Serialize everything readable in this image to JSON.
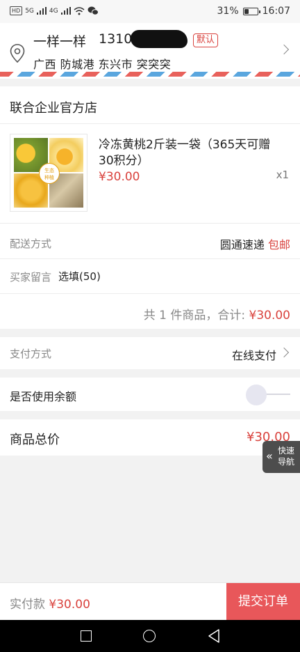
{
  "status_bar": {
    "left_icons": [
      "HD",
      "5G",
      "4G"
    ],
    "battery": "31%",
    "battery_level": 0.31,
    "time": "16:07"
  },
  "address": {
    "name": "一样一样",
    "phone": "1310",
    "default_badge": "默认",
    "line": "广西 防城港 东兴市   突突突"
  },
  "shop": {
    "name": "联合企业官方店",
    "product": {
      "title": "冷冻黄桃2斤装一袋（365天可赠30积分）",
      "price": "¥30.00",
      "qty": "x1",
      "image_text": "生态种植"
    },
    "delivery": {
      "label": "配送方式",
      "method": "圆通速递",
      "fee": "包邮"
    },
    "remark": {
      "label": "买家留言",
      "placeholder": "选填(50)"
    },
    "summary": {
      "prefix": "共 1 件商品，合计:",
      "amount": "¥30.00"
    }
  },
  "payment": {
    "label": "支付方式",
    "value": "在线支付"
  },
  "balance": {
    "label": "是否使用余额",
    "enabled": false
  },
  "total": {
    "label": "商品总价",
    "amount": "¥30.00"
  },
  "quick_nav": {
    "label": "快速导航"
  },
  "bottom": {
    "label": "实付款",
    "amount": "¥30.00",
    "submit": "提交订单"
  },
  "nav_bar": {
    "buttons": [
      "recent-apps",
      "home",
      "back"
    ]
  },
  "colors": {
    "accent": "#d9423d",
    "submit_bg": "#e8575a"
  }
}
